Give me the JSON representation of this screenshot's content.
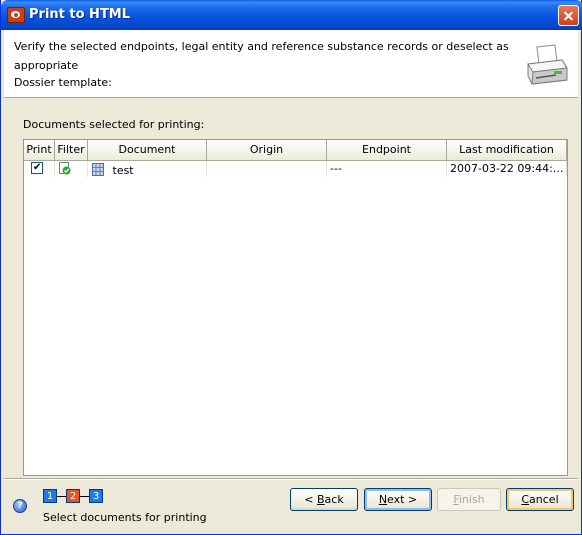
{
  "window": {
    "title": "Print to HTML"
  },
  "header": {
    "line1": "Verify the selected endpoints, legal entity and reference substance records or deselect as",
    "line2": "appropriate",
    "line3": "Dossier template:",
    "icon": "printer-icon"
  },
  "documents_label": "Documents selected for printing:",
  "table": {
    "columns": [
      "Print",
      "Filter",
      "Document",
      "Origin",
      "Endpoint",
      "Last modification"
    ],
    "rows": [
      {
        "print_checked": true,
        "filter_icon": "filter-check-icon",
        "document": "test",
        "origin": "",
        "endpoint": "---",
        "last_modification": "2007-03-22 09:44:..."
      }
    ]
  },
  "wizard": {
    "steps": [
      {
        "label": "1",
        "color": "#1e7ae8"
      },
      {
        "label": "2",
        "color": "#e8542a"
      },
      {
        "label": "3",
        "color": "#1e7ae8"
      }
    ],
    "current_step_caption": "Select documents for printing"
  },
  "buttons": {
    "back": {
      "prefix": "< ",
      "mnemonic": "B",
      "rest": "ack"
    },
    "next": {
      "mnemonic": "N",
      "rest": "ext >"
    },
    "finish": {
      "mnemonic": "F",
      "rest": "inish",
      "enabled": false
    },
    "cancel": {
      "mnemonic": "C",
      "rest": "ancel"
    }
  },
  "colors": {
    "titlebar": "#0754e3",
    "dialog_bg": "#ece9d8",
    "accent": "#e8542a"
  }
}
